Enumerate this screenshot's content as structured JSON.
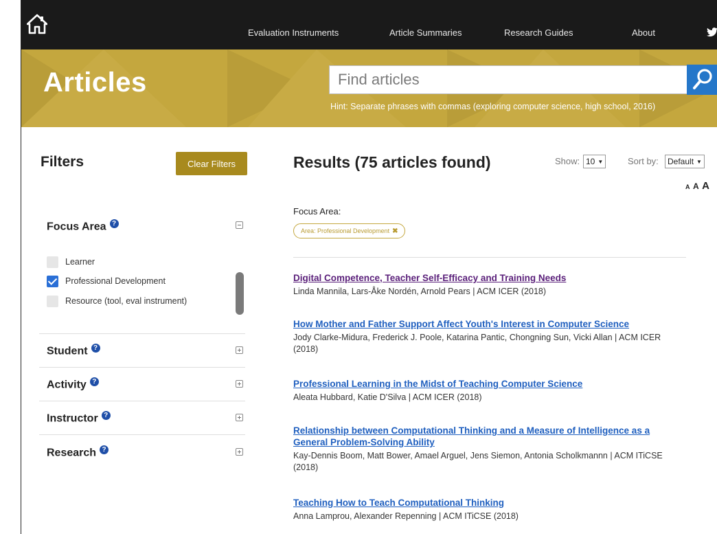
{
  "nav": {
    "links": [
      "Evaluation Instruments",
      "Article Summaries",
      "Research Guides",
      "About"
    ]
  },
  "hero": {
    "title": "Articles",
    "search_placeholder": "Find articles",
    "hint": "Hint: Separate phrases with commas (exploring computer science, high school, 2016)"
  },
  "filters": {
    "title": "Filters",
    "clear_label": "Clear Filters",
    "sections": [
      {
        "label": "Focus Area",
        "expanded": true
      },
      {
        "label": "Student",
        "expanded": false
      },
      {
        "label": "Activity",
        "expanded": false
      },
      {
        "label": "Instructor",
        "expanded": false
      },
      {
        "label": "Research",
        "expanded": false
      }
    ],
    "focus_options": [
      {
        "label": "Learner",
        "checked": false
      },
      {
        "label": "Professional Development",
        "checked": true
      },
      {
        "label": "Resource (tool, eval instrument)",
        "checked": false
      }
    ]
  },
  "results": {
    "title": "Results (75 articles found)",
    "show_label": "Show:",
    "show_value": "10",
    "sort_label": "Sort by:",
    "sort_value": "Default",
    "active_filter_heading": "Focus Area:",
    "active_filter_tag": "Area: Professional Development",
    "articles": [
      {
        "title": "Digital Competence, Teacher Self-Efficacy and Training Needs",
        "meta": "Linda Mannila, Lars-Åke Nordén, Arnold Pears | ACM ICER (2018)",
        "visited": true
      },
      {
        "title": "How Mother and Father Support Affect Youth's Interest in Computer Science",
        "meta": "Jody Clarke-Midura, Frederick J. Poole, Katarina Pantic, Chongning Sun, Vicki Allan | ACM ICER (2018)",
        "visited": false
      },
      {
        "title": "Professional Learning in the Midst of Teaching Computer Science",
        "meta": "Aleata Hubbard, Katie D'Silva | ACM ICER (2018)",
        "visited": false
      },
      {
        "title": "Relationship between Computational Thinking and a Measure of Intelligence as a General Problem-Solving Ability",
        "meta": "Kay-Dennis Boom, Matt Bower, Amael Arguel, Jens Siemon, Antonia Scholkmannn | ACM ITiCSE (2018)",
        "visited": false
      },
      {
        "title": "Teaching How to Teach Computational Thinking",
        "meta": "Anna Lamprou, Alexander Repenning | ACM ITiCSE (2018)",
        "visited": false
      }
    ]
  },
  "colors": {
    "nav_bg": "#1a1a1a",
    "hero_bg": "#c4a73e",
    "accent_button": "#a88a1e",
    "search_button": "#2577c9",
    "link": "#1f5fbf",
    "visited_link": "#5a1f7a"
  },
  "icons": [
    "home-icon",
    "twitter-icon",
    "search-icon",
    "help-icon",
    "collapse-icon",
    "expand-icon",
    "checkmark-icon",
    "close-icon"
  ]
}
